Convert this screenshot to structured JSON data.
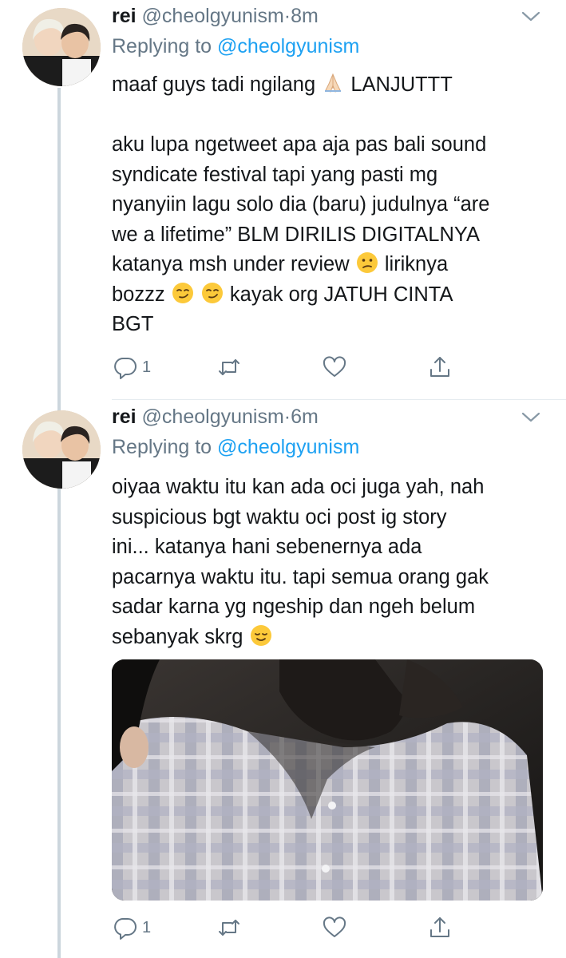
{
  "tweets": [
    {
      "display_name": "rei",
      "handle": "@cheolgyunism",
      "separator": "·",
      "time": "8m",
      "replying_prefix": "Replying to",
      "replying_to": "@cheolgyunism",
      "line1_a": "maaf guys tadi ngilang ",
      "line1_b": " LANJUTTT",
      "para2_a": "aku lupa ngetweet apa aja pas bali sound\nsyndicate festival tapi yang pasti mg\nnyanyiin lagu solo dia (baru) judulnya “are\nwe a lifetime” BLM DIRILIS DIGITALNYA\nkatanya msh under review ",
      "para2_b": " liriknya\nbozzz ",
      "para2_c": " kayak org JATUH CINTA\nBGT",
      "reply_count": "1",
      "icons": {
        "reply": "reply-icon",
        "retweet": "retweet-icon",
        "like": "heart-icon",
        "share": "share-icon"
      }
    },
    {
      "display_name": "rei",
      "handle": "@cheolgyunism",
      "separator": "·",
      "time": "6m",
      "replying_prefix": "Replying to",
      "replying_to": "@cheolgyunism",
      "text_a": "oiyaa waktu itu kan ada oci juga yah, nah\nsuspicious bgt waktu oci post ig story\nini... katanya hani sebenernya ada\npacarnya waktu itu. tapi semua orang gak\nsadar karna yg ngeship dan ngeh belum\nsebanyak skrg ",
      "reply_count": "1",
      "icons": {
        "reply": "reply-icon",
        "retweet": "retweet-icon",
        "like": "heart-icon",
        "share": "share-icon"
      }
    }
  ],
  "colors": {
    "link": "#1da1f2",
    "secondary": "#657786",
    "thread_line": "#ccd6dd"
  }
}
